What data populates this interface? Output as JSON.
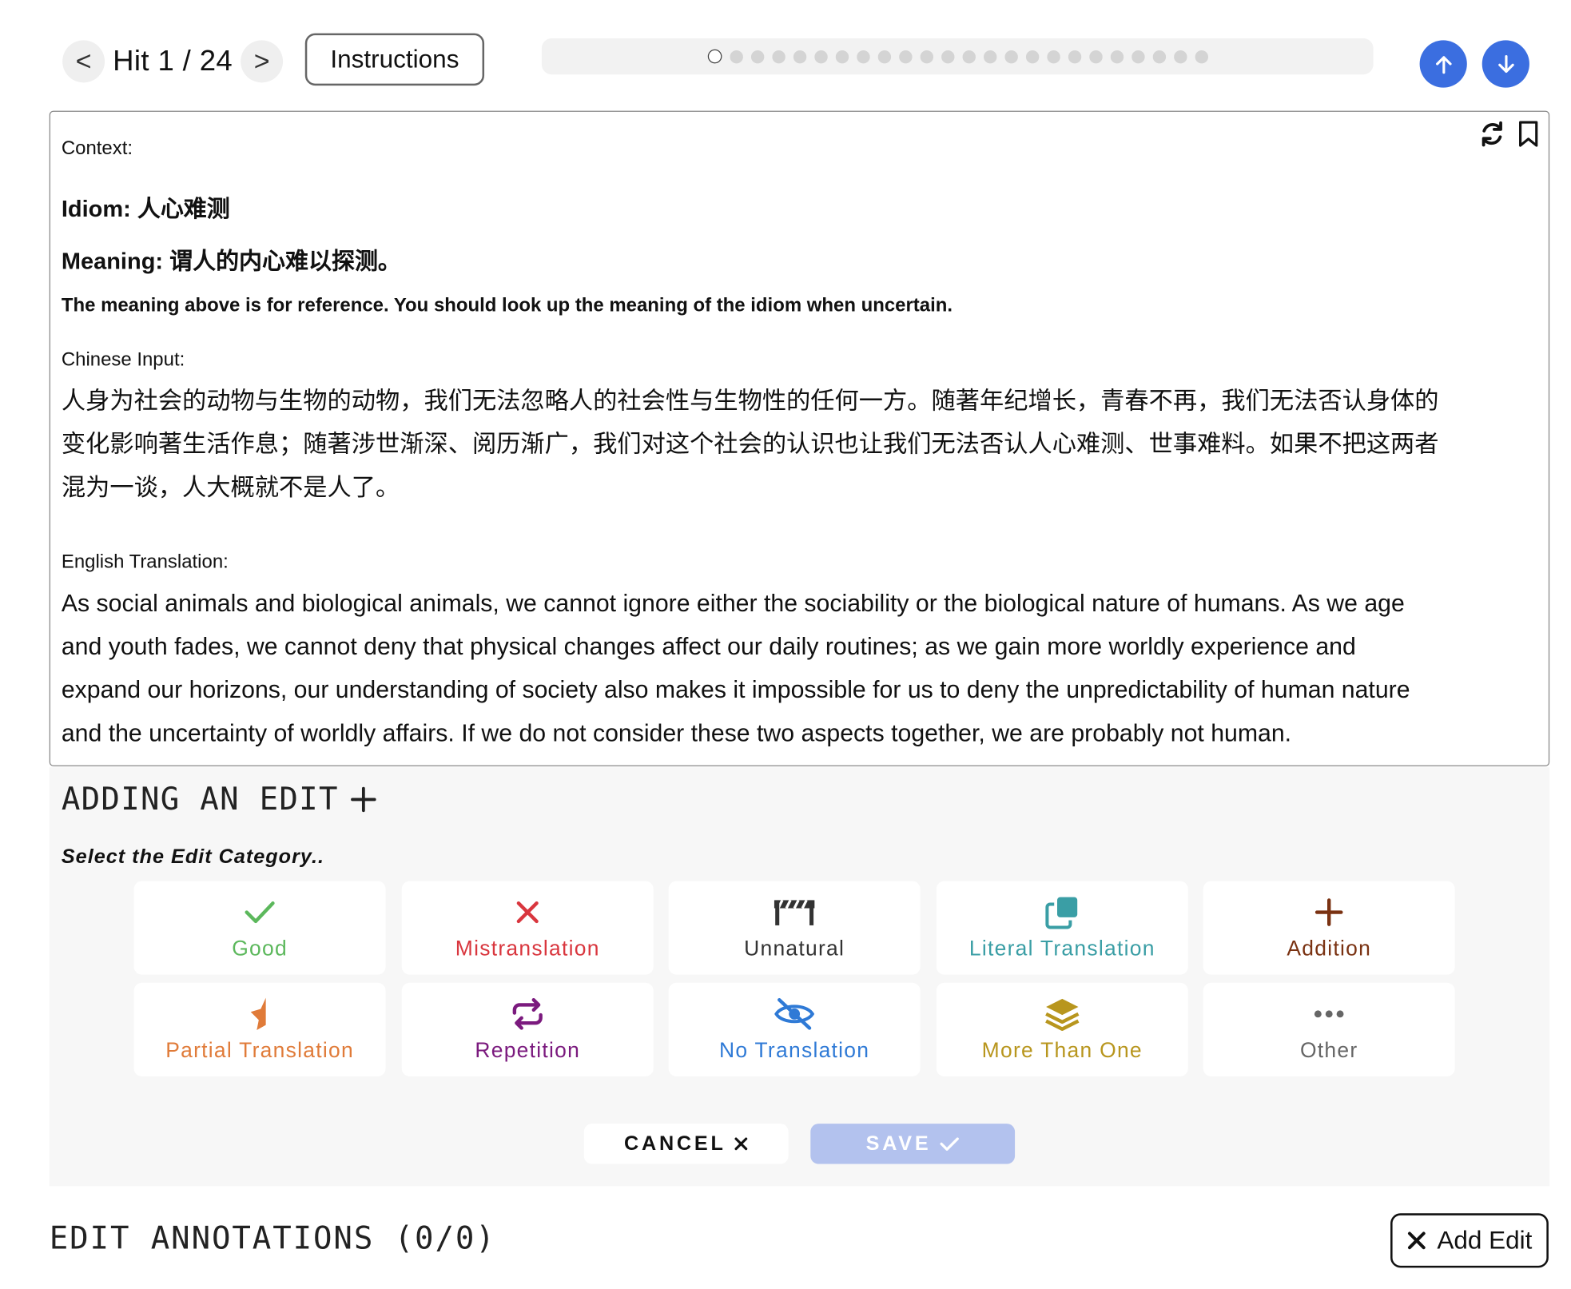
{
  "nav": {
    "prev": "<",
    "next": ">",
    "hit_label": "Hit 1 / 24",
    "instructions": "Instructions",
    "progress_total": 24,
    "progress_current": 1
  },
  "context": {
    "context_label": "Context:",
    "idiom_label": "Idiom:",
    "idiom_value": "人心难测",
    "meaning_label": "Meaning:",
    "meaning_value": "谓人的内心难以探测。",
    "reference_note": "The meaning above is for reference. You should look up the meaning of the idiom when uncertain.",
    "chinese_label": "Chinese Input:",
    "chinese_lines": [
      "人身为社会的动物与生物的动物，我们无法忽略人的社会性与生物性的任何一方。随著年纪增长，青春不再，我们无法否认身体的",
      "变化影响著生活作息；随著涉世渐深、阅历渐广，我们对这个社会的认识也让我们无法否认人心难测、世事难料。如果不把这两者",
      "混为一谈，人大概就不是人了。"
    ],
    "english_label": "English Translation:",
    "english_lines": [
      "As social animals and biological animals, we cannot ignore either the sociability or the biological nature of humans. As we age",
      "and youth fades, we cannot deny that physical changes affect our daily routines; as we gain more worldly experience and",
      "expand our horizons, our understanding of society also makes it impossible for us to deny the unpredictability of human nature",
      "and the uncertainty of worldly affairs. If we do not consider these two aspects together, we are probably not human."
    ]
  },
  "edit": {
    "title": "ADDING AN EDIT",
    "select_prompt": "Select the Edit Category..",
    "categories": [
      {
        "label": "Good",
        "color": "#5cb85c",
        "icon": "check-icon"
      },
      {
        "label": "Mistranslation",
        "color": "#d9363e",
        "icon": "x-icon"
      },
      {
        "label": "Unnatural",
        "color": "#333333",
        "icon": "barrier-icon"
      },
      {
        "label": "Literal Translation",
        "color": "#3a9ea5",
        "icon": "copy-icon"
      },
      {
        "label": "Addition",
        "color": "#7a3212",
        "icon": "plus-icon"
      },
      {
        "label": "Partial Translation",
        "color": "#e07b39",
        "icon": "half-star-icon"
      },
      {
        "label": "Repetition",
        "color": "#7b1a7e",
        "icon": "repeat-icon"
      },
      {
        "label": "No Translation",
        "color": "#2f7ad6",
        "icon": "eye-slash-icon"
      },
      {
        "label": "More Than One",
        "color": "#b8961e",
        "icon": "layers-icon"
      },
      {
        "label": "Other",
        "color": "#666666",
        "icon": "ellipsis-icon"
      }
    ],
    "cancel": "CANCEL",
    "save": "SAVE"
  },
  "annotations": {
    "title": "EDIT ANNOTATIONS (0/0)",
    "add_edit": "Add Edit"
  },
  "colors": {
    "accent_blue": "#3b6ee0",
    "save_disabled": "#b3c2ee"
  }
}
